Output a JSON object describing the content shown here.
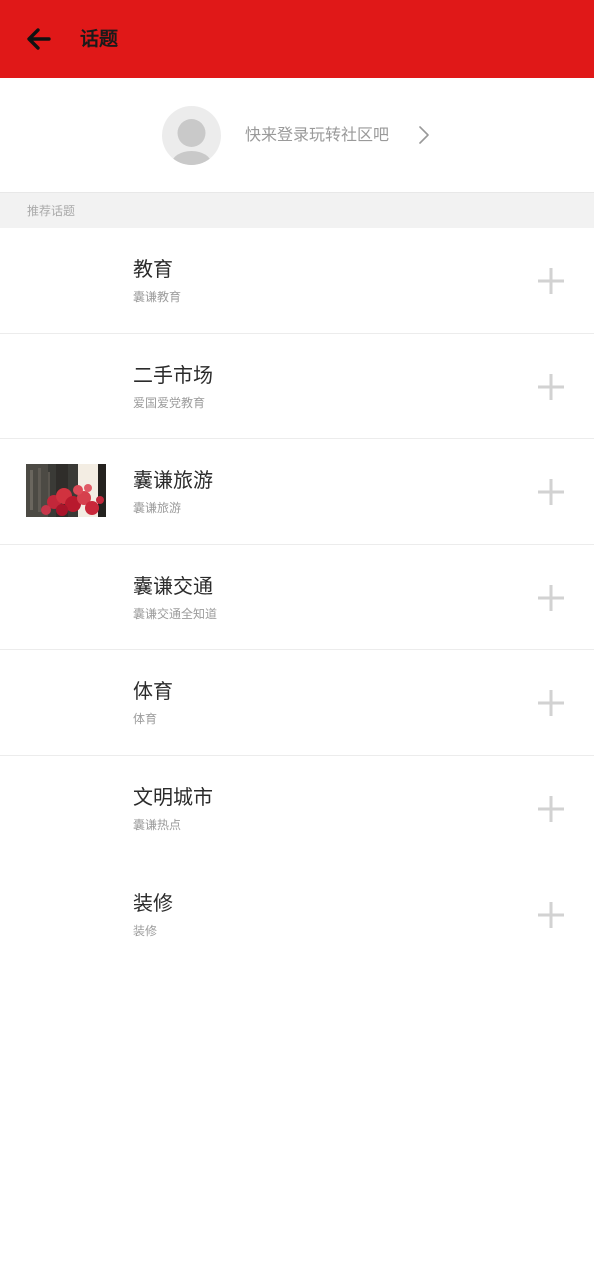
{
  "header": {
    "title": "话题",
    "back_icon": "arrow-left-icon",
    "background_color": "#e01818"
  },
  "login": {
    "prompt": "快来登录玩转社区吧",
    "avatar_icon": "default-avatar-icon",
    "chevron_icon": "chevron-right-icon"
  },
  "section": {
    "title": "推荐话题"
  },
  "topics": [
    {
      "name": "教育",
      "description": "囊谦教育",
      "has_thumbnail": false
    },
    {
      "name": "二手市场",
      "description": "爱国爱党教育",
      "has_thumbnail": false
    },
    {
      "name": "囊谦旅游",
      "description": "囊谦旅游",
      "has_thumbnail": true
    },
    {
      "name": "囊谦交通",
      "description": "囊谦交通全知道",
      "has_thumbnail": false
    },
    {
      "name": "体育",
      "description": "体育",
      "has_thumbnail": false
    },
    {
      "name": "文明城市",
      "description": "囊谦热点",
      "has_thumbnail": false
    },
    {
      "name": "装修",
      "description": "装修",
      "has_thumbnail": false
    }
  ],
  "follow_icon": "plus-icon"
}
